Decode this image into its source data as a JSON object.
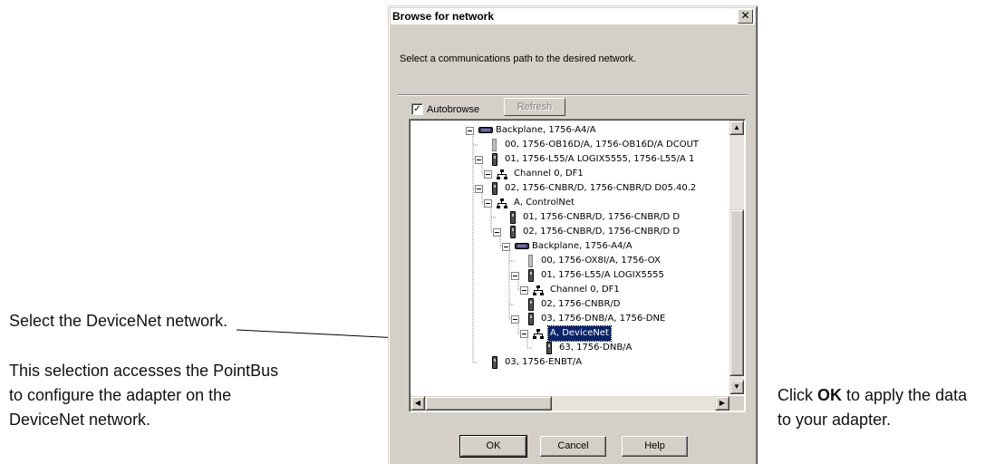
{
  "dialog": {
    "title": "Browse for network",
    "close_glyph": "✕",
    "instruction": "Select a communications path to the desired network.",
    "autobrowse_label": "Autobrowse",
    "autobrowse_checked": true,
    "refresh_label": "Refresh",
    "buttons": {
      "ok": "OK",
      "cancel": "Cancel",
      "help": "Help"
    }
  },
  "tree": {
    "nodes": [
      {
        "text": "Backplane, 1756-A4/A",
        "icon": "backplane-icon",
        "expander": true
      },
      {
        "text": "00, 1756-OB16D/A, 1756-OB16D/A  DCOUT",
        "icon": "slot-icon",
        "expander": false
      },
      {
        "text": "01, 1756-L55/A LOGIX5555, 1756-L55/A 1",
        "icon": "module-icon",
        "expander": true
      },
      {
        "text": "Channel 0, DF1",
        "icon": "network-icon",
        "expander": true
      },
      {
        "text": "02, 1756-CNBR/D, 1756-CNBR/D D05.40.2",
        "icon": "module-icon",
        "expander": true
      },
      {
        "text": "A, ControlNet",
        "icon": "network-icon",
        "expander": true
      },
      {
        "text": "01, 1756-CNBR/D, 1756-CNBR/D D",
        "icon": "module-icon",
        "expander": false
      },
      {
        "text": "02, 1756-CNBR/D, 1756-CNBR/D D",
        "icon": "module-icon",
        "expander": true
      },
      {
        "text": "Backplane, 1756-A4/A",
        "icon": "backplane-icon",
        "expander": true
      },
      {
        "text": "00, 1756-OX8I/A, 1756-OX",
        "icon": "slot-icon",
        "expander": false
      },
      {
        "text": "01, 1756-L55/A LOGIX5555",
        "icon": "module-icon",
        "expander": true
      },
      {
        "text": "Channel 0, DF1",
        "icon": "network-icon",
        "expander": true
      },
      {
        "text": "02, 1756-CNBR/D",
        "icon": "module-icon",
        "expander": false
      },
      {
        "text": "03, 1756-DNB/A, 1756-DNE",
        "icon": "module-icon",
        "expander": true
      },
      {
        "text": "A, DeviceNet",
        "icon": "network-icon",
        "expander": true,
        "selected": true
      },
      {
        "text": "63, 1756-DNB/A",
        "icon": "module-icon",
        "expander": false
      },
      {
        "text": "03, 1756-ENBT/A",
        "icon": "module-icon",
        "expander": false
      }
    ]
  },
  "callouts": {
    "select": "Select the DeviceNet network.",
    "access_line1": "This selection accesses the PointBus",
    "access_line2": "to configure the adapter on the",
    "access_line3": "DeviceNet network.",
    "ok_prefix": "Click ",
    "ok_bold": "OK",
    "ok_suffix": " to apply the data",
    "ok_line2": "to your adapter."
  }
}
